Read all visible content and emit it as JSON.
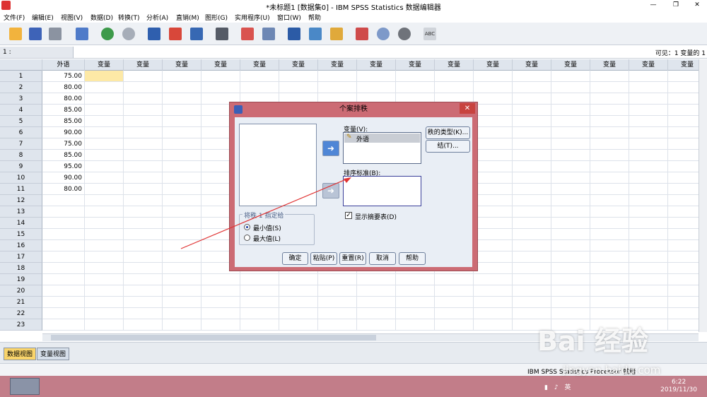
{
  "window": {
    "title": "*未标题1 [数据集0] - IBM SPSS Statistics 数据编辑器",
    "minimize": "—",
    "restore": "❐",
    "close": "✕"
  },
  "menu": [
    "文件(F)",
    "编辑(E)",
    "视图(V)",
    "数据(D)",
    "转换(T)",
    "分析(A)",
    "直销(M)",
    "图形(G)",
    "实用程序(U)",
    "窗口(W)",
    "帮助"
  ],
  "toolbar": {
    "icons": [
      "open-icon",
      "save-icon",
      "print-icon",
      "dialog-recall-icon",
      "undo-icon",
      "redo-icon",
      "goto-case-icon",
      "goto-variable-icon",
      "variables-icon",
      "find-icon",
      "insert-cases-icon",
      "insert-variable-icon",
      "split-file-icon",
      "weight-cases-icon",
      "select-cases-icon",
      "value-labels-icon",
      "use-variable-sets-icon",
      "show-all-variables-icon",
      "spell-check-icon"
    ],
    "spell_label": "ABC"
  },
  "editor": {
    "cell_ref": "1 :",
    "visible_label": "可见：1 变量的 1"
  },
  "grid": {
    "var_name": "外语",
    "empty_header": "变量",
    "rows": [
      "1",
      "2",
      "3",
      "4",
      "5",
      "6",
      "7",
      "8",
      "9",
      "10",
      "11",
      "12",
      "13",
      "14",
      "15",
      "16",
      "17",
      "18",
      "19",
      "20",
      "21",
      "22",
      "23"
    ],
    "values": [
      "75.00",
      "80.00",
      "80.00",
      "85.00",
      "85.00",
      "90.00",
      "75.00",
      "85.00",
      "95.00",
      "90.00",
      "80.00"
    ]
  },
  "view_tabs": {
    "data_view": "数据视图",
    "variable_view": "变量视图"
  },
  "status": {
    "processor": "IBM SPSS Statistics Processor 就绪"
  },
  "taskbar": {
    "time": "6:22",
    "date": "2019/11/30",
    "ime": "英"
  },
  "dialog": {
    "title": "个案排秩",
    "variables_label": "变量(V):",
    "variable_item": "外语",
    "sort_by_label": "排序标准(B):",
    "rank_types_button": "秩的类型(K)...",
    "ties_button": "结(T)...",
    "assign_rank_legend": "将秩 1 指定给",
    "smallest_label": "最小值(S)",
    "largest_label": "最大值(L)",
    "summary_label": "显示摘要表(D)",
    "ok": "确定",
    "paste": "粘贴(P)",
    "reset": "重置(R)",
    "cancel": "取消",
    "help": "帮助",
    "close": "✕"
  },
  "watermark": {
    "text": "Bai 经验",
    "url": "jingyan.baidu.com"
  }
}
